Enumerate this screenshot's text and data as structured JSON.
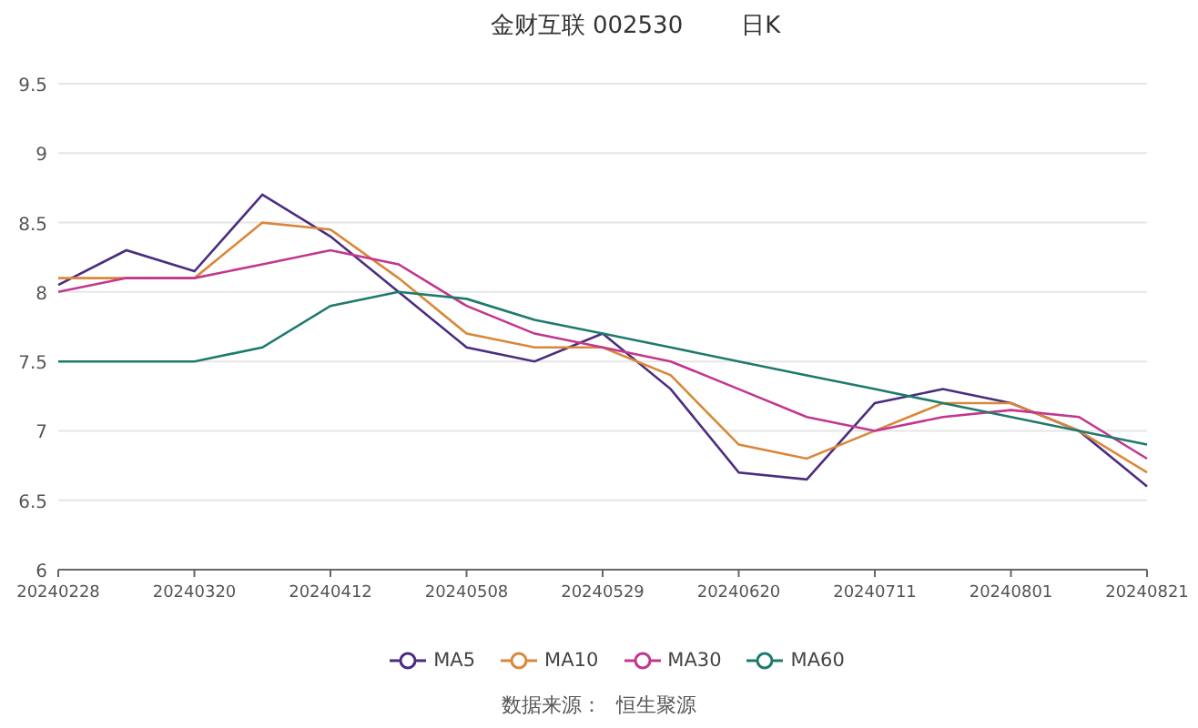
{
  "header": {
    "stock": "金财互联 002530",
    "period": "日K"
  },
  "chart": {
    "chart_data": {
      "type": "line",
      "categories": [
        "20240228",
        null,
        "20240320",
        null,
        "20240412",
        null,
        "20240508",
        null,
        "20240529",
        null,
        "20240620",
        null,
        "20240711",
        null,
        "20240801",
        null,
        "20240821"
      ],
      "ylim": [
        6,
        9.5
      ],
      "grid": true,
      "yticks": [
        {
          "value": 6,
          "label": "6"
        },
        {
          "value": 6.5,
          "label": "6.5"
        },
        {
          "value": 7,
          "label": "7"
        },
        {
          "value": 7.5,
          "label": "7.5"
        },
        {
          "value": 8,
          "label": "8"
        },
        {
          "value": 8.5,
          "label": "8.5"
        },
        {
          "value": 9,
          "label": "9"
        },
        {
          "value": 9.5,
          "label": "9.5"
        }
      ],
      "series": [
        {
          "name": "MA5",
          "color": "#4b2c7f",
          "values": [
            8.05,
            8.3,
            8.15,
            8.7,
            8.4,
            8.0,
            7.6,
            7.5,
            7.7,
            7.3,
            6.7,
            6.65,
            7.2,
            7.3,
            7.2,
            7.0,
            6.6
          ]
        },
        {
          "name": "MA10",
          "color": "#d9883a",
          "values": [
            8.1,
            8.1,
            8.1,
            8.5,
            8.45,
            8.1,
            7.7,
            7.6,
            7.6,
            7.4,
            6.9,
            6.8,
            7.0,
            7.2,
            7.2,
            7.0,
            6.7
          ]
        },
        {
          "name": "MA30",
          "color": "#c2378f",
          "values": [
            8.0,
            8.1,
            8.1,
            8.2,
            8.3,
            8.2,
            7.9,
            7.7,
            7.6,
            7.5,
            7.3,
            7.1,
            7.0,
            7.1,
            7.15,
            7.1,
            6.8
          ]
        },
        {
          "name": "MA60",
          "color": "#1f7a6e",
          "values": [
            7.5,
            7.5,
            7.5,
            7.6,
            7.9,
            8.0,
            7.95,
            7.8,
            7.7,
            7.6,
            7.5,
            7.4,
            7.3,
            7.2,
            7.1,
            7.0,
            6.9
          ]
        }
      ]
    }
  },
  "source": {
    "label": "数据来源：",
    "value": "恒生聚源"
  }
}
